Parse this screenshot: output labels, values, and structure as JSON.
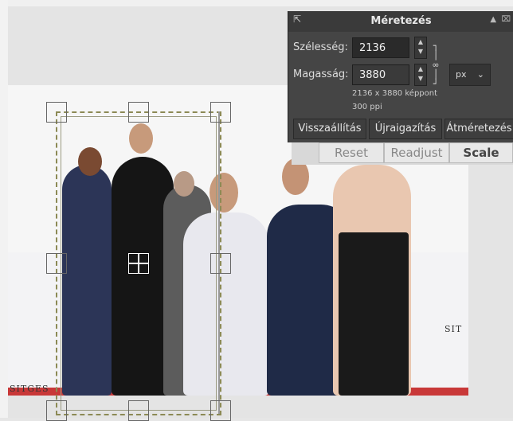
{
  "dialog": {
    "title": "Méretezés",
    "width_label": "Szélesség:",
    "width_value": "2136",
    "height_label": "Magasság:",
    "height_value": "3880",
    "unit": "px",
    "pixel_info": "2136 x 3880 képpont",
    "ppi_info": "300 ppi",
    "buttons": {
      "reset": "Visszaállítás",
      "readjust": "Újraigazítás",
      "scale": "Átméretezés"
    }
  },
  "underlying_bar": {
    "reset": "Reset",
    "readjust": "Readjust",
    "scale": "Scale"
  },
  "photo": {
    "logo_text": "SITGES",
    "logo_text_right": "SIT"
  },
  "colors": {
    "dialog_bg": "#454545",
    "frame": "#8c8a55",
    "carpet": "#c83838"
  }
}
